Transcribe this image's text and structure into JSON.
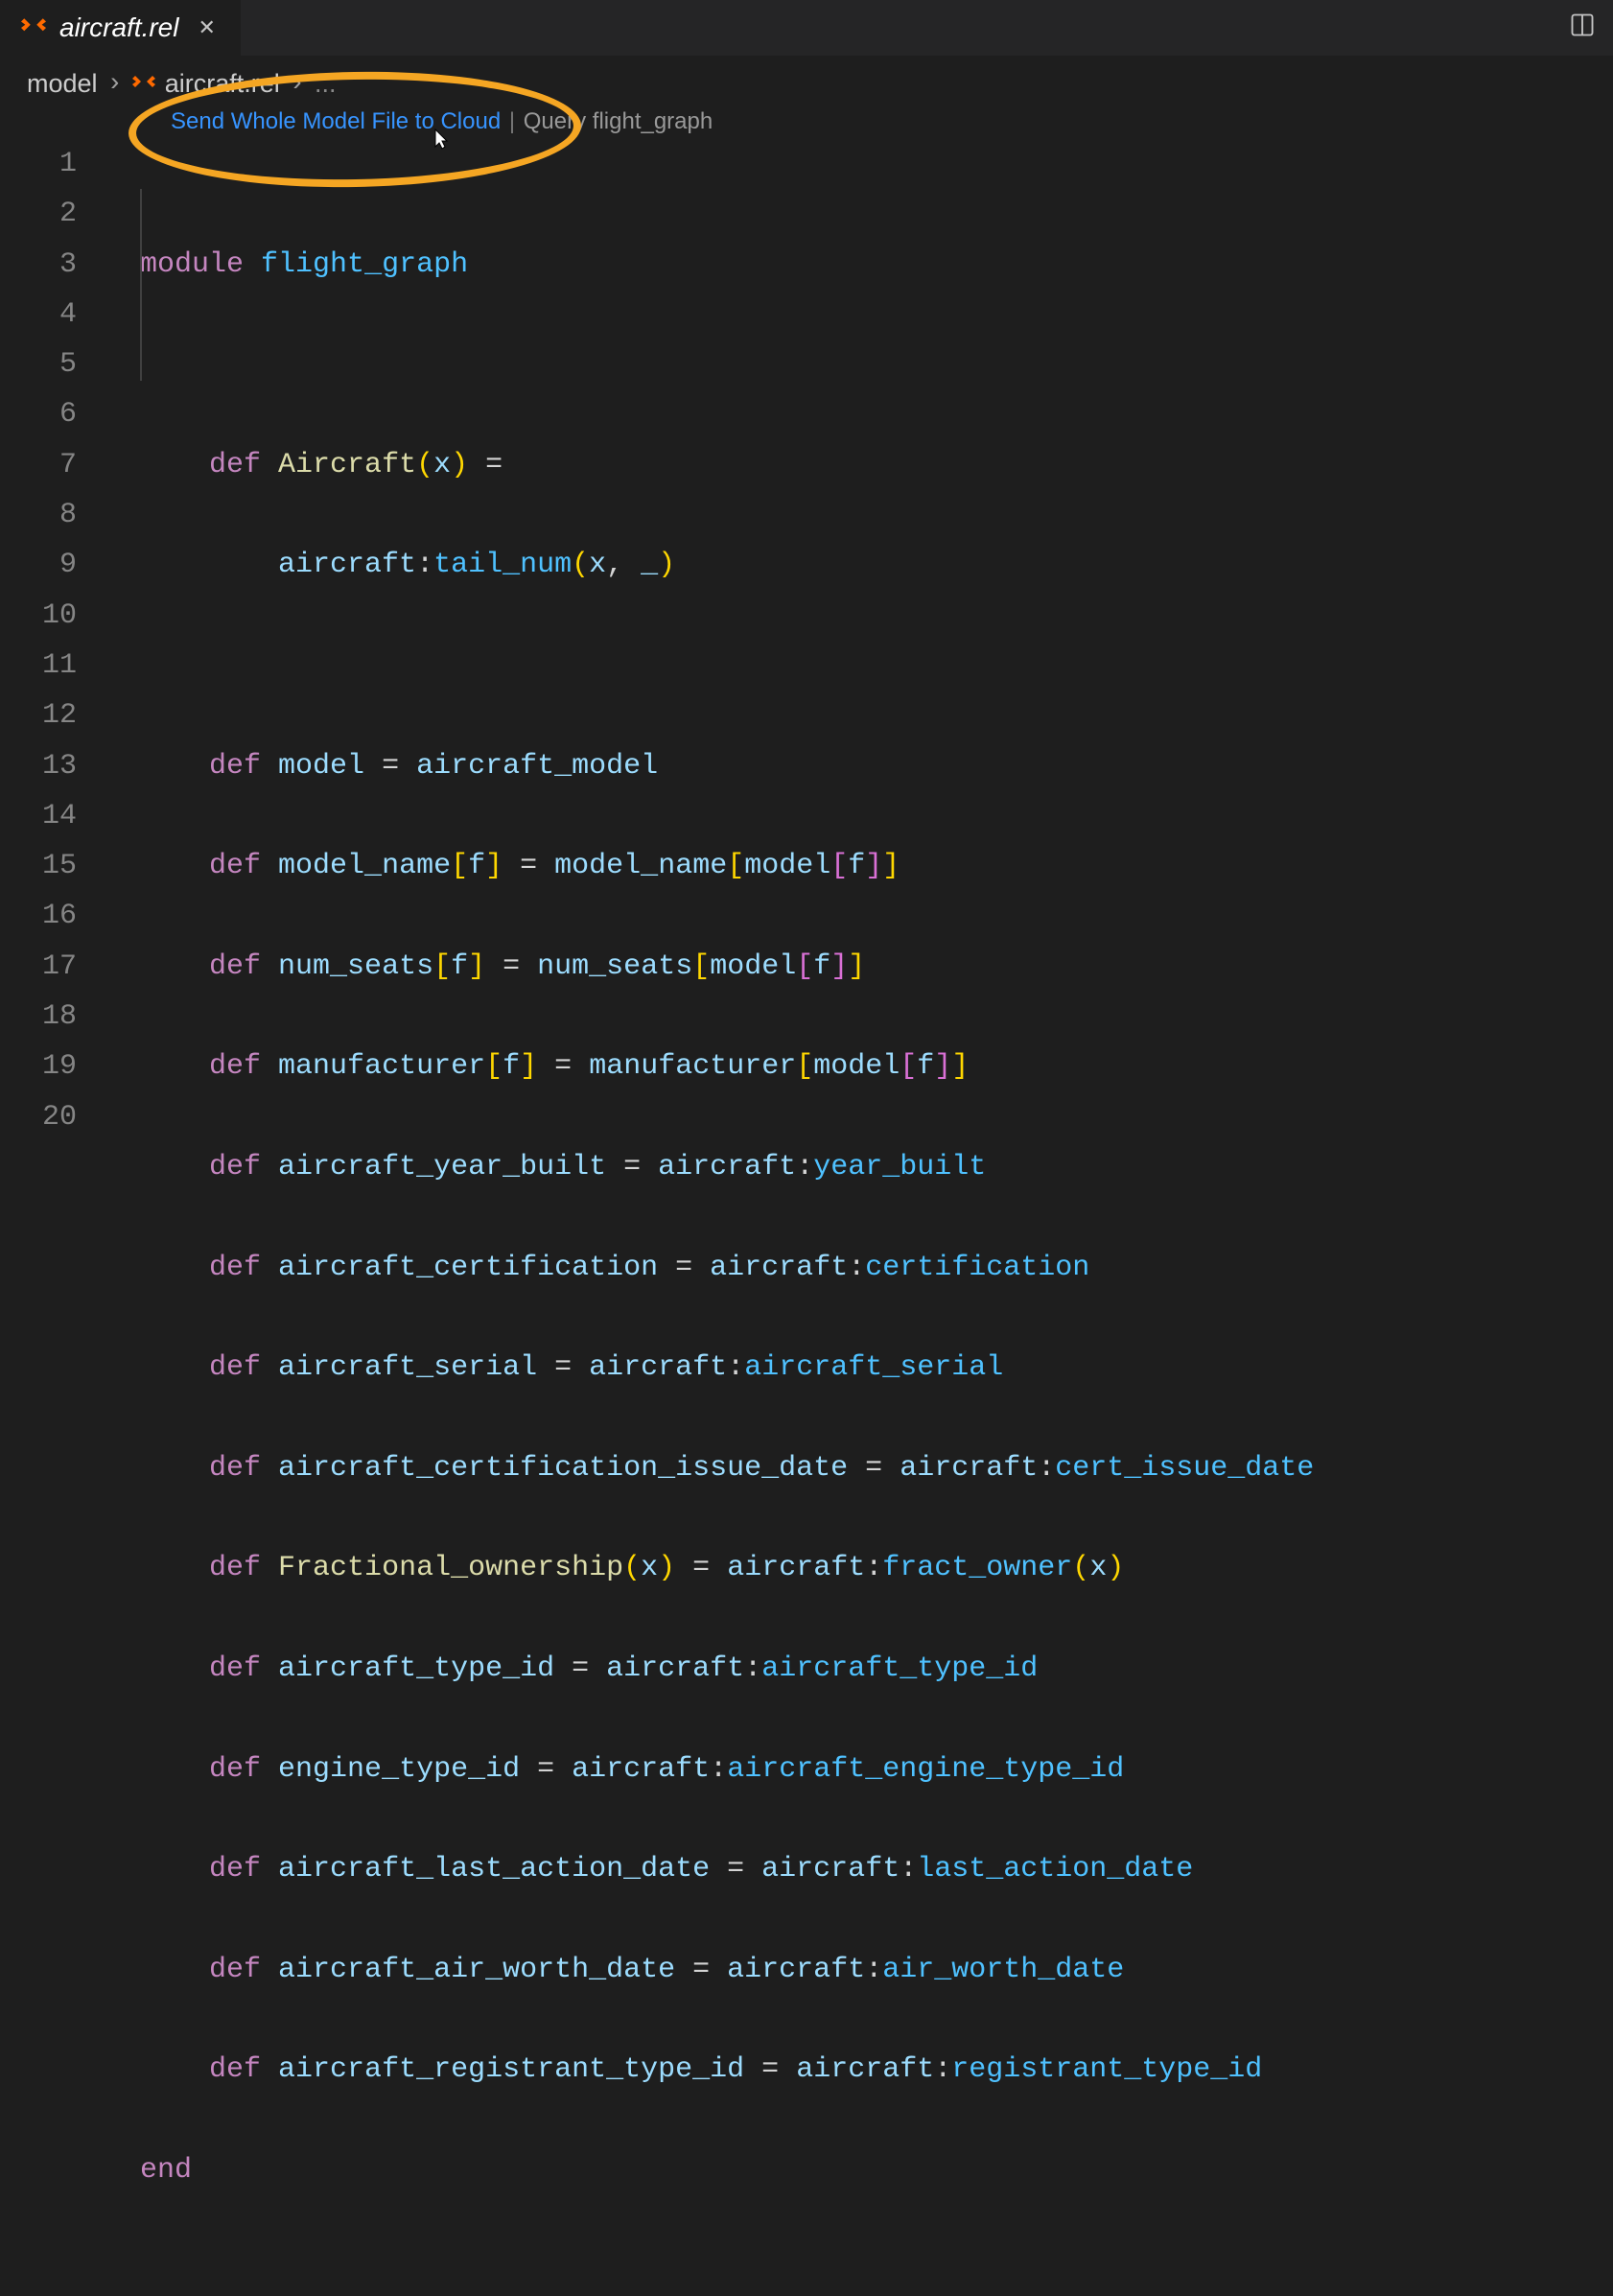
{
  "tab": {
    "filename": "aircraft.rel",
    "close_label": "✕"
  },
  "breadcrumb": {
    "seg1": "model",
    "seg2": "aircraft.rel",
    "seg3": "..."
  },
  "codelens": {
    "link1": "Send Whole Model File to Cloud",
    "sep": "|",
    "link2": "Query flight_graph"
  },
  "lines": {
    "n1": "1",
    "n2": "2",
    "n3": "3",
    "n4": "4",
    "n5": "5",
    "n6": "6",
    "n7": "7",
    "n8": "8",
    "n9": "9",
    "n10": "10",
    "n11": "11",
    "n12": "12",
    "n13": "13",
    "n14": "14",
    "n15": "15",
    "n16": "16",
    "n17": "17",
    "n18": "18",
    "n19": "19",
    "n20": "20"
  },
  "code": {
    "l1_kw": "module",
    "l1_name": "flight_graph",
    "l3_kw": "def",
    "l3_fn": "Aircraft",
    "l3_param": "x",
    "l3_eq": "=",
    "l4_obj": "aircraft",
    "l4_colon": ":",
    "l4_prop": "tail_num",
    "l4_p1": "x",
    "l4_p2": "_",
    "l6_kw": "def",
    "l6_lhs": "model",
    "l6_eq": "=",
    "l6_rhs": "aircraft_model",
    "l7_kw": "def",
    "l7_lhs": "model_name",
    "l7_param": "f",
    "l7_eq": "=",
    "l7_rhs": "model_name",
    "l7_inner": "model",
    "l7_p": "f",
    "l8_kw": "def",
    "l8_lhs": "num_seats",
    "l8_param": "f",
    "l8_eq": "=",
    "l8_rhs": "num_seats",
    "l8_inner": "model",
    "l8_p": "f",
    "l9_kw": "def",
    "l9_lhs": "manufacturer",
    "l9_param": "f",
    "l9_eq": "=",
    "l9_rhs": "manufacturer",
    "l9_inner": "model",
    "l9_p": "f",
    "l10_kw": "def",
    "l10_lhs": "aircraft_year_built",
    "l10_eq": "=",
    "l10_obj": "aircraft",
    "l10_colon": ":",
    "l10_prop": "year_built",
    "l11_kw": "def",
    "l11_lhs": "aircraft_certification",
    "l11_eq": "=",
    "l11_obj": "aircraft",
    "l11_colon": ":",
    "l11_prop": "certification",
    "l12_kw": "def",
    "l12_lhs": "aircraft_serial",
    "l12_eq": "=",
    "l12_obj": "aircraft",
    "l12_colon": ":",
    "l12_prop": "aircraft_serial",
    "l13_kw": "def",
    "l13_lhs": "aircraft_certification_issue_date",
    "l13_eq": "=",
    "l13_obj": "aircraft",
    "l13_colon": ":",
    "l13_prop": "cert_issue_date",
    "l14_kw": "def",
    "l14_fn": "Fractional_ownership",
    "l14_param": "x",
    "l14_eq": "=",
    "l14_obj": "aircraft",
    "l14_colon": ":",
    "l14_prop": "fract_owner",
    "l14_p2": "x",
    "l15_kw": "def",
    "l15_lhs": "aircraft_type_id",
    "l15_eq": "=",
    "l15_obj": "aircraft",
    "l15_colon": ":",
    "l15_prop": "aircraft_type_id",
    "l16_kw": "def",
    "l16_lhs": "engine_type_id",
    "l16_eq": "=",
    "l16_obj": "aircraft",
    "l16_colon": ":",
    "l16_prop": "aircraft_engine_type_id",
    "l17_kw": "def",
    "l17_lhs": "aircraft_last_action_date",
    "l17_eq": "=",
    "l17_obj": "aircraft",
    "l17_colon": ":",
    "l17_prop": "last_action_date",
    "l18_kw": "def",
    "l18_lhs": "aircraft_air_worth_date",
    "l18_eq": "=",
    "l18_obj": "aircraft",
    "l18_colon": ":",
    "l18_prop": "air_worth_date",
    "l19_kw": "def",
    "l19_lhs": "aircraft_registrant_type_id",
    "l19_eq": "=",
    "l19_obj": "aircraft",
    "l19_colon": ":",
    "l19_prop": "registrant_type_id",
    "l20_kw": "end"
  }
}
